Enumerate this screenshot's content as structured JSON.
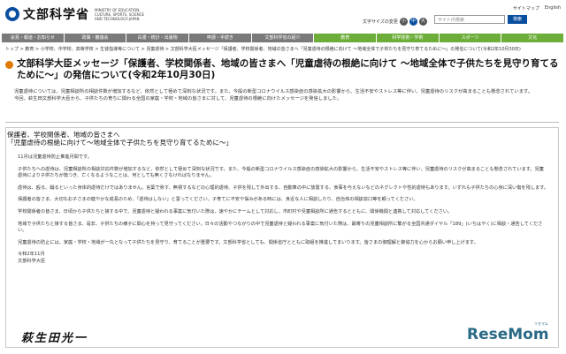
{
  "header": {
    "logo_text": "文部科学省",
    "logo_sub": "MINISTRY OF EDUCATION, CULTURE, SPORTS, SCIENCE AND TECHNOLOGY-JAPAN",
    "util_links": [
      "サイトマップ",
      "English"
    ],
    "font_size_label": "文字サイズの変更",
    "font_sizes": [
      "小",
      "中",
      "大"
    ],
    "search_placeholder": "サイト内検索",
    "search_button": "検索"
  },
  "nav": [
    {
      "label": "会見・報道・お知らせ"
    },
    {
      "label": "政策・審議会"
    },
    {
      "label": "白書・統計・出版物"
    },
    {
      "label": "申請・手続き"
    },
    {
      "label": "文部科学省の紹介"
    },
    {
      "label": "教育"
    },
    {
      "label": "科学技術・学術"
    },
    {
      "label": "スポーツ"
    },
    {
      "label": "文化"
    }
  ],
  "breadcrumb": "トップ > 教育 > 小学校、中学校、高等学校 > 生徒指導等について > 児童虐待 > 文部科学大臣メッセージ「保護者、学校関係者、地域の皆さまへ「児童虐待の根絶に向けて ～地域全体で子供たちを見守り育てるために～」の発信について(令和2年10月30日)",
  "page_title": "文部科学大臣メッセージ「保護者、学校関係者、地域の皆さまへ「児童虐待の根絶に向けて ～地域全体で子供たちを見守り育てるために～」の発信について(令和2年10月30日)",
  "intro": [
    "児童虐待については、児童相談所の相談件数が増加するなど、依然として極めて深刻な状況です。また、今般の新型コロナウイルス感染症の感染拡大の影響から、生活不安やストレス等に伴い、児童虐待のリスクが高まることも懸念されています。",
    "今回、萩生田文部科学大臣から、子供たちの育ちに関わる全国の家庭・学校・地域の皆さまに対して、児童虐待の根絶に向けたメッセージを発信しました。"
  ],
  "card": {
    "heading_line1": "保護者、学校関係者、地域の皆さまへ",
    "heading_line2": "「児童虐待の根絶に向けて～地域全体で子供たちを見守り育てるために～」",
    "paragraphs": [
      "11月は児童虐待防止推進月間です。",
      "子供たちへの虐待は、児童相談所の相談対応件数が増加するなど、依然として極めて深刻な状況です。また、今般の新型コロナウイルス感染症の感染拡大の影響から、生活不安やストレス等に伴い、児童虐待のリスクが高まることも懸念されています。児童虐待により子供たちが傷つき、亡くなるようなことは、何としても無くさなければなりません。",
      "虐待は、殴る、蹴るといった身体的虐待だけではありません。言葉で脅す、無視するなどの心理的虐待、子供を残して外出する、自動車の中に放置する、食事を与えないなどのネグレクトや性的虐待もあります。いずれも子供たちの心身に深い傷を残します。",
      "保護者の皆さま、大切なお子さまの健やかな成長のため、「虐待はしない」と誓ってください。子育てに不安や悩みがある時には、身近な人に相談したり、自治体の相談窓口等を頼ってください。",
      "学校関係者の皆さま、日頃から子供たちと接する中で、児童虐待と疑われる事案に気付いた際は、速やかにチームとして対応し、市町村や児童相談所に通告するとともに、関係機関と連携して対応してください。",
      "地域で子供たちと接する皆さま、是非、子供たちの様子に関心を持って見守ってください。日々の活動やつながりの中で児童虐待と疑われる事案に気付いた際は、最寄りの児童相談所に繋がる全国共通ダイヤル「189」(いちはやく)に相談・通告してください。",
      "児童虐待の防止には、家庭・学校・地域が一丸となって子供たちを見守り、育てることが重要です。文部科学省としても、関係省庁とともに取組を推進してまいります。皆さまの御理解と御協力を心からお願い申し上げます。"
    ],
    "date": "令和2年11月",
    "signer": "文部科学大臣",
    "signature": "萩生田光一"
  },
  "watermark": "ReseMom",
  "watermark_sub": "リセマム"
}
